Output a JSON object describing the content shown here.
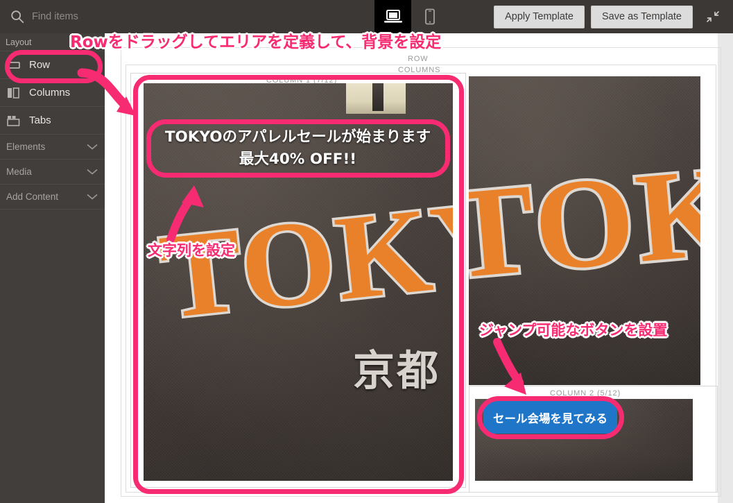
{
  "toolbar": {
    "search_placeholder": "Find items",
    "search_value": "",
    "search_icon": "search-icon",
    "devices": [
      {
        "name": "desktop-view",
        "icon": "laptop-icon",
        "active": true
      },
      {
        "name": "mobile-view",
        "icon": "phone-icon",
        "active": false
      }
    ],
    "apply_template_label": "Apply Template",
    "save_template_label": "Save as Template",
    "collapse_icon": "collapse-arrows-icon"
  },
  "sidebar": {
    "section_title": "Layout",
    "items": [
      {
        "label": "Row",
        "icon": "row-icon",
        "active": true
      },
      {
        "label": "Columns",
        "icon": "columns-icon",
        "active": false
      },
      {
        "label": "Tabs",
        "icon": "tabs-icon",
        "active": false
      }
    ],
    "sections": [
      {
        "label": "Elements",
        "icon": "chevron-down-icon"
      },
      {
        "label": "Media",
        "icon": "chevron-down-icon"
      },
      {
        "label": "Add Content",
        "icon": "chevron-down-icon"
      }
    ]
  },
  "canvas": {
    "row_label": "ROW",
    "columns_label": "COLUMNS",
    "column1_label": "COLUMN 1 (7/12)",
    "column2_label": "COLUMN 2 (5/12)",
    "headline_line1": "TOKYOのアパレルセールが始まります",
    "headline_line2": "最大40% OFF!!",
    "cta_label": "セール会場を見てみる",
    "shirt_text_left": "TOKYO",
    "shirt_text_left_sub": "京都",
    "shirt_text_right": "TOKYO"
  },
  "annotations": {
    "top": "Rowをドラッグしてエリアを定義して、背景を設定",
    "string": "文字列を設定",
    "button": "ジャンプ可能なボタンを設置"
  },
  "colors": {
    "accent_pink": "#f72b72",
    "cta_blue": "#1f76c8",
    "chrome_dark": "#3b3836",
    "sidebar_dark": "#413e3c"
  }
}
